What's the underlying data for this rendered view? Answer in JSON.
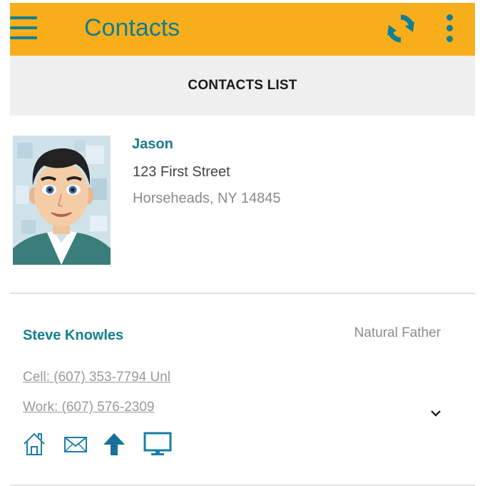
{
  "app": {
    "title": "Contacts",
    "colors": {
      "appbar": "#f8ae1b",
      "accent": "#127c8f"
    },
    "icons": {
      "menu": "menu-icon",
      "refresh": "refresh-icon",
      "more": "more-vertical-icon"
    }
  },
  "section": {
    "title": "CONTACTS LIST"
  },
  "student": {
    "name": "Jason",
    "address_line1": "123 First Street",
    "address_line2": "Horseheads, NY 14845"
  },
  "contact": {
    "name": "Steve Knowles",
    "relationship": "Natural Father",
    "phones": [
      {
        "label": "Cell: (607) 353-7794 Unl"
      },
      {
        "label": "Work: (607) 576-2309"
      }
    ],
    "actions": [
      "home-icon",
      "email-icon",
      "upload-arrow-icon",
      "computer-monitor-icon"
    ]
  }
}
